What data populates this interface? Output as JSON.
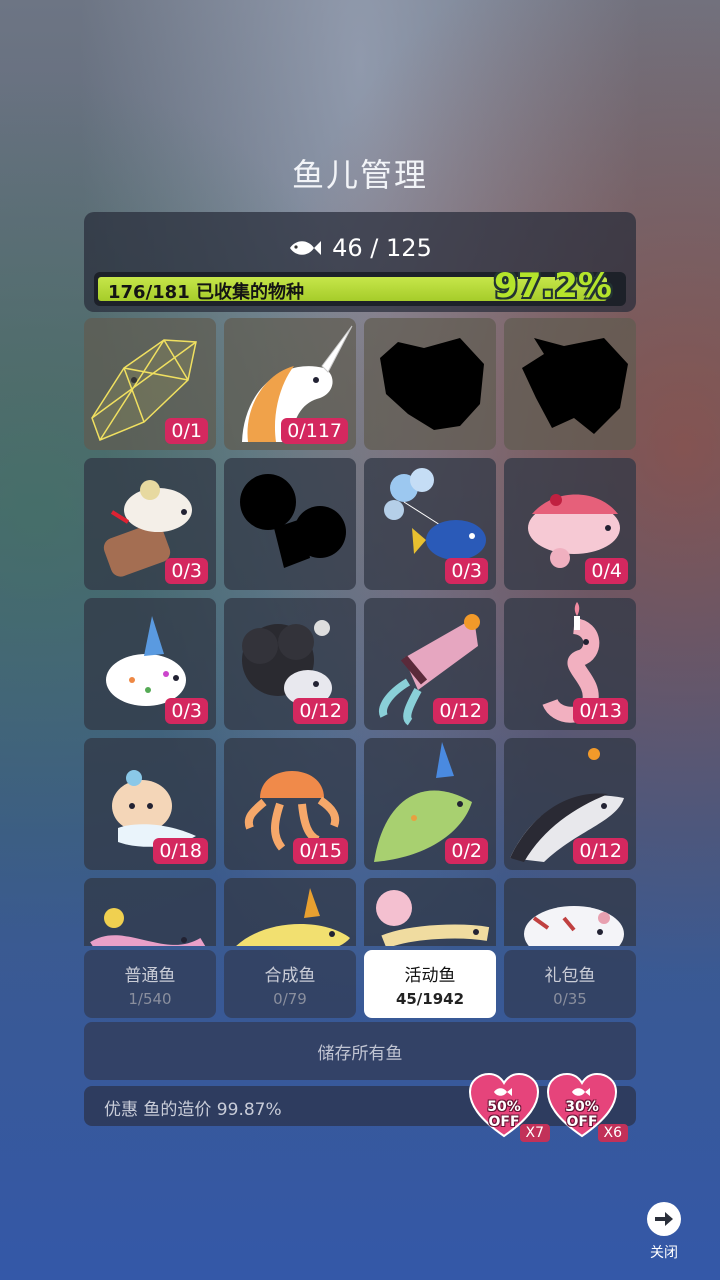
{
  "title": "鱼儿管理",
  "stats": {
    "fish_count": "46 / 125",
    "species_text": "176/181 已收集的物种",
    "percent": "97.2%",
    "progress_fraction": 0.972
  },
  "fish_tiles": [
    {
      "name": "wireframe-crystal-fish",
      "count": "0/1",
      "silhouette": false
    },
    {
      "name": "unicorn-fish",
      "count": "0/117",
      "silhouette": false
    },
    {
      "name": "unknown-fish-1",
      "count": "",
      "silhouette": true
    },
    {
      "name": "unknown-fish-2",
      "count": "",
      "silhouette": true
    },
    {
      "name": "sundae-fish",
      "count": "0/3",
      "silhouette": false
    },
    {
      "name": "unknown-fish-3",
      "count": "",
      "silhouette": true
    },
    {
      "name": "balloon-fish",
      "count": "0/3",
      "silhouette": false
    },
    {
      "name": "strawberry-cake-fish",
      "count": "0/4",
      "silhouette": false
    },
    {
      "name": "party-hat-puffer",
      "count": "0/3",
      "silhouette": false
    },
    {
      "name": "wool-sheep-fish",
      "count": "0/12",
      "silhouette": false
    },
    {
      "name": "cake-squid",
      "count": "0/12",
      "silhouette": false
    },
    {
      "name": "candle-seahorse",
      "count": "0/13",
      "silhouette": false
    },
    {
      "name": "cream-cow-fish",
      "count": "0/18",
      "silhouette": false
    },
    {
      "name": "jellyfish",
      "count": "0/15",
      "silhouette": false
    },
    {
      "name": "party-sunfish",
      "count": "0/2",
      "silhouette": false
    },
    {
      "name": "dolphin",
      "count": "0/12",
      "silhouette": false
    },
    {
      "name": "candy-eel",
      "count": "",
      "silhouette": false
    },
    {
      "name": "party-whale",
      "count": "",
      "silhouette": false
    },
    {
      "name": "balloon-eel",
      "count": "",
      "silhouette": false
    },
    {
      "name": "cake-cat-fish",
      "count": "",
      "silhouette": false
    }
  ],
  "tabs": [
    {
      "label": "普通鱼",
      "count": "1/540",
      "active": false
    },
    {
      "label": "合成鱼",
      "count": "0/79",
      "active": false
    },
    {
      "label": "活动鱼",
      "count": "45/1942",
      "active": true
    },
    {
      "label": "礼包鱼",
      "count": "0/35",
      "active": false
    }
  ],
  "store_all_label": "储存所有鱼",
  "discount_text": "优惠 鱼的造价 99.87%",
  "offers": [
    {
      "pct": "50%",
      "off": "OFF",
      "mult": "X7"
    },
    {
      "pct": "30%",
      "off": "OFF",
      "mult": "X6"
    }
  ],
  "close_label": "关闭",
  "colors": {
    "badge": "#d4285f",
    "progress": "#b4e42b",
    "offer_heart": "#e6447b"
  }
}
